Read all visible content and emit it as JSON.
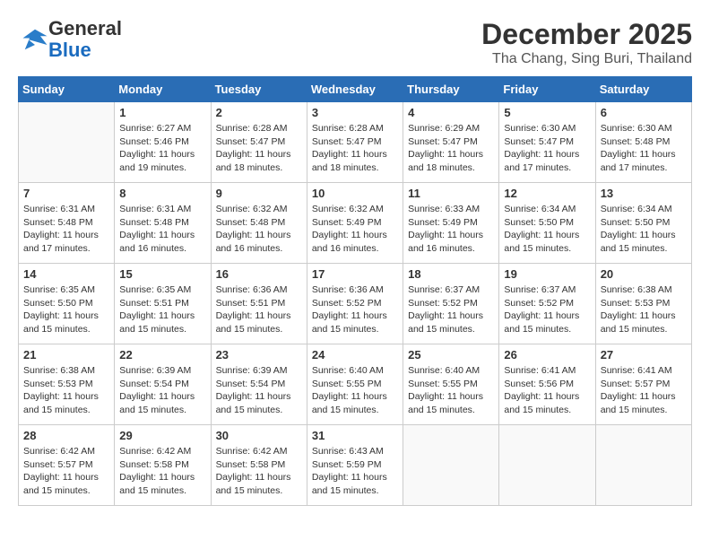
{
  "header": {
    "logo": {
      "line1": "General",
      "line2": "Blue"
    },
    "month_year": "December 2025",
    "location": "Tha Chang, Sing Buri, Thailand"
  },
  "days_of_week": [
    "Sunday",
    "Monday",
    "Tuesday",
    "Wednesday",
    "Thursday",
    "Friday",
    "Saturday"
  ],
  "weeks": [
    [
      {
        "day": "",
        "info": ""
      },
      {
        "day": "1",
        "info": "Sunrise: 6:27 AM\nSunset: 5:46 PM\nDaylight: 11 hours\nand 19 minutes."
      },
      {
        "day": "2",
        "info": "Sunrise: 6:28 AM\nSunset: 5:47 PM\nDaylight: 11 hours\nand 18 minutes."
      },
      {
        "day": "3",
        "info": "Sunrise: 6:28 AM\nSunset: 5:47 PM\nDaylight: 11 hours\nand 18 minutes."
      },
      {
        "day": "4",
        "info": "Sunrise: 6:29 AM\nSunset: 5:47 PM\nDaylight: 11 hours\nand 18 minutes."
      },
      {
        "day": "5",
        "info": "Sunrise: 6:30 AM\nSunset: 5:47 PM\nDaylight: 11 hours\nand 17 minutes."
      },
      {
        "day": "6",
        "info": "Sunrise: 6:30 AM\nSunset: 5:48 PM\nDaylight: 11 hours\nand 17 minutes."
      }
    ],
    [
      {
        "day": "7",
        "info": "Sunrise: 6:31 AM\nSunset: 5:48 PM\nDaylight: 11 hours\nand 17 minutes."
      },
      {
        "day": "8",
        "info": "Sunrise: 6:31 AM\nSunset: 5:48 PM\nDaylight: 11 hours\nand 16 minutes."
      },
      {
        "day": "9",
        "info": "Sunrise: 6:32 AM\nSunset: 5:48 PM\nDaylight: 11 hours\nand 16 minutes."
      },
      {
        "day": "10",
        "info": "Sunrise: 6:32 AM\nSunset: 5:49 PM\nDaylight: 11 hours\nand 16 minutes."
      },
      {
        "day": "11",
        "info": "Sunrise: 6:33 AM\nSunset: 5:49 PM\nDaylight: 11 hours\nand 16 minutes."
      },
      {
        "day": "12",
        "info": "Sunrise: 6:34 AM\nSunset: 5:50 PM\nDaylight: 11 hours\nand 15 minutes."
      },
      {
        "day": "13",
        "info": "Sunrise: 6:34 AM\nSunset: 5:50 PM\nDaylight: 11 hours\nand 15 minutes."
      }
    ],
    [
      {
        "day": "14",
        "info": "Sunrise: 6:35 AM\nSunset: 5:50 PM\nDaylight: 11 hours\nand 15 minutes."
      },
      {
        "day": "15",
        "info": "Sunrise: 6:35 AM\nSunset: 5:51 PM\nDaylight: 11 hours\nand 15 minutes."
      },
      {
        "day": "16",
        "info": "Sunrise: 6:36 AM\nSunset: 5:51 PM\nDaylight: 11 hours\nand 15 minutes."
      },
      {
        "day": "17",
        "info": "Sunrise: 6:36 AM\nSunset: 5:52 PM\nDaylight: 11 hours\nand 15 minutes."
      },
      {
        "day": "18",
        "info": "Sunrise: 6:37 AM\nSunset: 5:52 PM\nDaylight: 11 hours\nand 15 minutes."
      },
      {
        "day": "19",
        "info": "Sunrise: 6:37 AM\nSunset: 5:52 PM\nDaylight: 11 hours\nand 15 minutes."
      },
      {
        "day": "20",
        "info": "Sunrise: 6:38 AM\nSunset: 5:53 PM\nDaylight: 11 hours\nand 15 minutes."
      }
    ],
    [
      {
        "day": "21",
        "info": "Sunrise: 6:38 AM\nSunset: 5:53 PM\nDaylight: 11 hours\nand 15 minutes."
      },
      {
        "day": "22",
        "info": "Sunrise: 6:39 AM\nSunset: 5:54 PM\nDaylight: 11 hours\nand 15 minutes."
      },
      {
        "day": "23",
        "info": "Sunrise: 6:39 AM\nSunset: 5:54 PM\nDaylight: 11 hours\nand 15 minutes."
      },
      {
        "day": "24",
        "info": "Sunrise: 6:40 AM\nSunset: 5:55 PM\nDaylight: 11 hours\nand 15 minutes."
      },
      {
        "day": "25",
        "info": "Sunrise: 6:40 AM\nSunset: 5:55 PM\nDaylight: 11 hours\nand 15 minutes."
      },
      {
        "day": "26",
        "info": "Sunrise: 6:41 AM\nSunset: 5:56 PM\nDaylight: 11 hours\nand 15 minutes."
      },
      {
        "day": "27",
        "info": "Sunrise: 6:41 AM\nSunset: 5:57 PM\nDaylight: 11 hours\nand 15 minutes."
      }
    ],
    [
      {
        "day": "28",
        "info": "Sunrise: 6:42 AM\nSunset: 5:57 PM\nDaylight: 11 hours\nand 15 minutes."
      },
      {
        "day": "29",
        "info": "Sunrise: 6:42 AM\nSunset: 5:58 PM\nDaylight: 11 hours\nand 15 minutes."
      },
      {
        "day": "30",
        "info": "Sunrise: 6:42 AM\nSunset: 5:58 PM\nDaylight: 11 hours\nand 15 minutes."
      },
      {
        "day": "31",
        "info": "Sunrise: 6:43 AM\nSunset: 5:59 PM\nDaylight: 11 hours\nand 15 minutes."
      },
      {
        "day": "",
        "info": ""
      },
      {
        "day": "",
        "info": ""
      },
      {
        "day": "",
        "info": ""
      }
    ]
  ]
}
